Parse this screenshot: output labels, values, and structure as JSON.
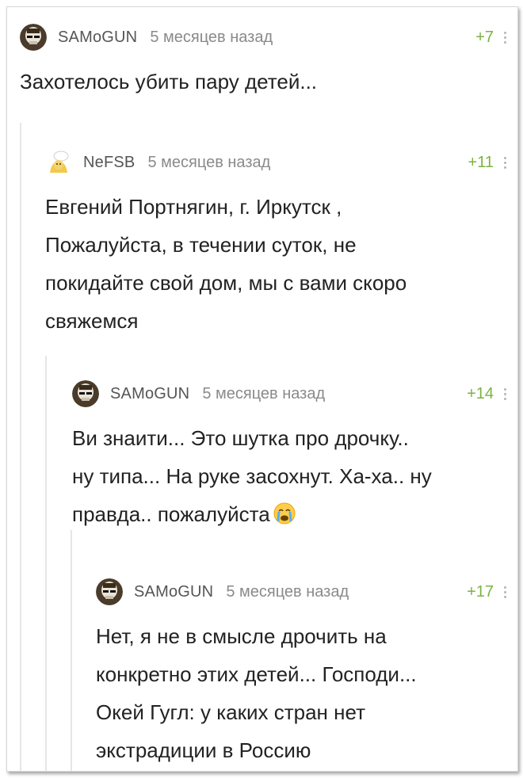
{
  "comments": [
    {
      "username": "SAMoGUN",
      "time": "5 месяцев назад",
      "rating": "+7",
      "lines": [
        "Захотелось убить пару детей..."
      ]
    },
    {
      "username": "NeFSB",
      "time": "5 месяцев назад",
      "rating": "+11",
      "lines": [
        "Евгений Портнягин, г. Иркутск ,",
        "Пожалуйста, в течении суток, не",
        "покидайте свой дом, мы с вами скоро",
        "свяжемся"
      ]
    },
    {
      "username": "SAMoGUN",
      "time": "5 месяцев назад",
      "rating": "+14",
      "lines": [
        "Ви знаити... Это шутка про дрочку..",
        "ну типа... На руке засохнут. Ха-ха.. ну",
        "правда.. пожалуйста"
      ]
    },
    {
      "username": "SAMoGUN",
      "time": "5 месяцев назад",
      "rating": "+17",
      "lines": [
        "Нет, я не в смысле дрочить на",
        "конкретно этих детей... Господи...",
        "Окей Гугл: у каких стран нет",
        "экстрадиции в Россию"
      ]
    }
  ],
  "icons": {
    "avatar_samogun": "skull-avatar-icon",
    "avatar_nefsb": "cartoon-avatar-icon",
    "emoji": "crying-face-emoji"
  },
  "colors": {
    "rating": "#7cb342",
    "username": "#555555",
    "time": "#8a8a8a",
    "text": "#222222"
  }
}
